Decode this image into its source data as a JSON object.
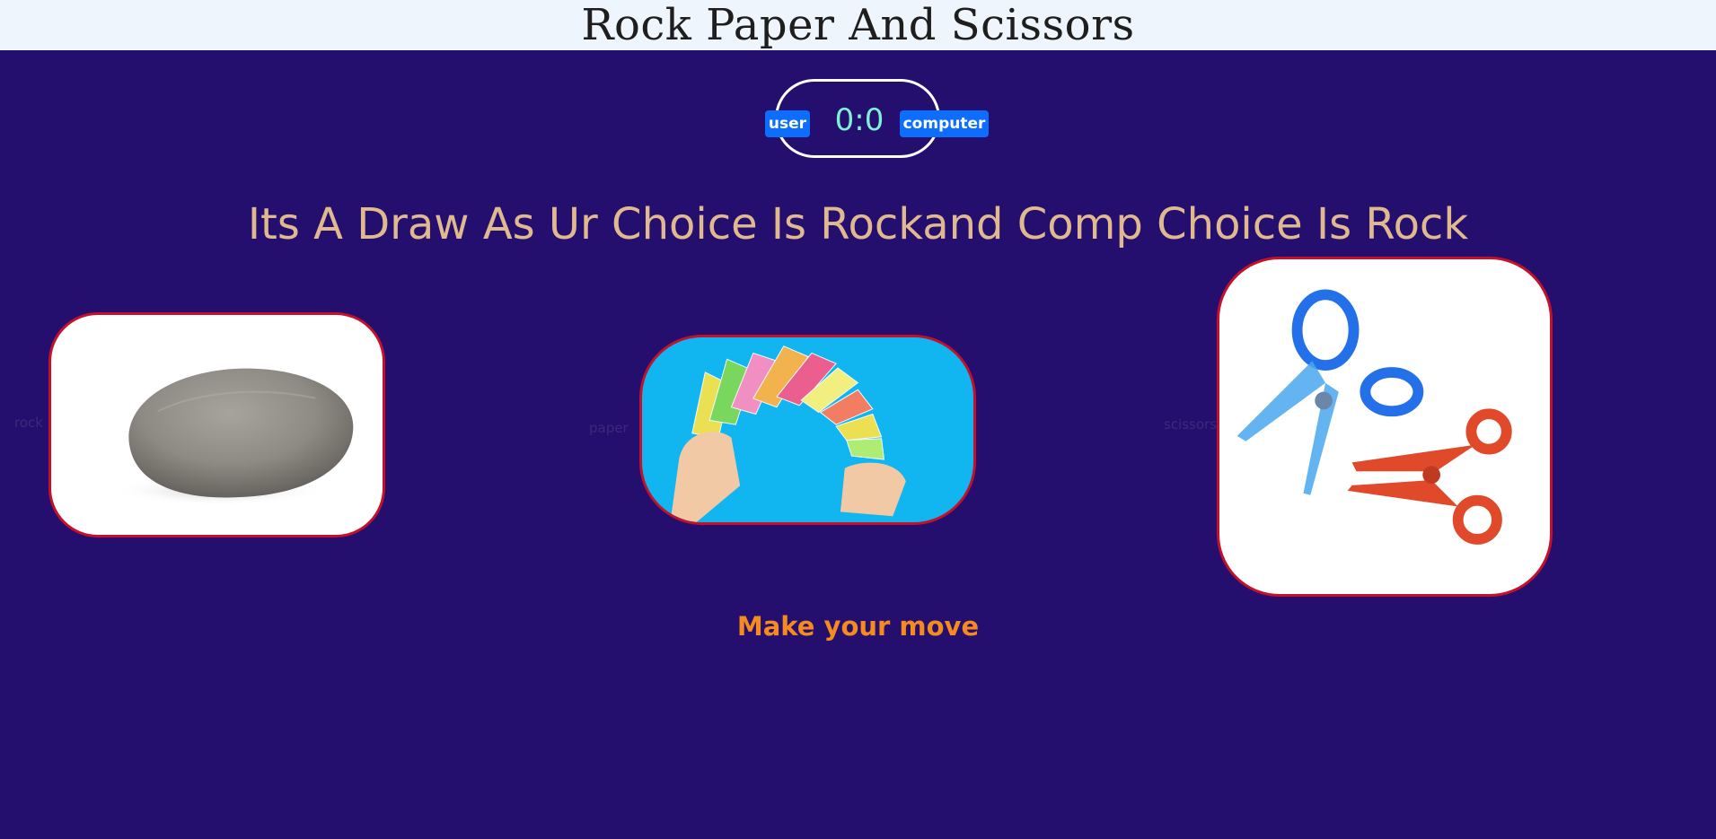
{
  "header": {
    "title": "Rock Paper And Scissors"
  },
  "score": {
    "text": "0:0",
    "user_label": "user",
    "computer_label": "computer"
  },
  "result_message": "Its A Draw As Ur Choice Is Rockand Comp Choice Is Rock",
  "choices": [
    {
      "id": "rock",
      "label": "rock",
      "icon": "rock-image"
    },
    {
      "id": "paper",
      "label": "paper",
      "icon": "paper-image"
    },
    {
      "id": "scissors",
      "label": "scissors",
      "icon": "scissors-image"
    }
  ],
  "prompt": "Make your move",
  "colors": {
    "background": "#240f6f",
    "header_bg": "#eef5fd",
    "score_text": "#7ff0d4",
    "badge": "#0d6efd",
    "message": "#e1b98f",
    "choice_border": "#c4102a",
    "prompt": "#f58a1f"
  }
}
